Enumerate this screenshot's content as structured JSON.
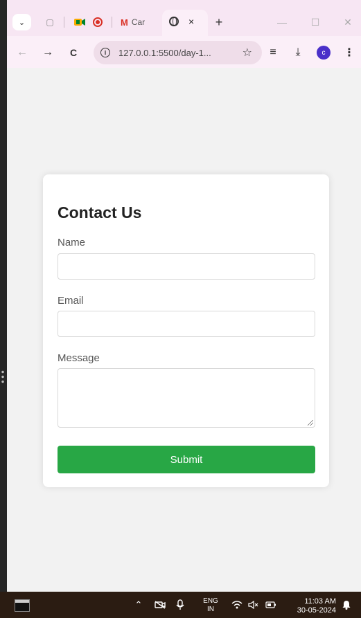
{
  "browser": {
    "tabs": {
      "gmail_title": "Car",
      "active_close": "×",
      "new_tab": "+"
    },
    "window_controls": {
      "minimize": "—",
      "maximize": "☐",
      "close": "✕"
    },
    "toolbar": {
      "back": "←",
      "forward": "→",
      "reload": "C",
      "url": "127.0.0.1:5500/day-1...",
      "star": "☆",
      "reading_list": "≡",
      "download": "⤓",
      "profile_initial": "c",
      "menu": "⋮"
    }
  },
  "form": {
    "title": "Contact Us",
    "name_label": "Name",
    "name_value": "",
    "email_label": "Email",
    "email_value": "",
    "message_label": "Message",
    "message_value": "",
    "submit_label": "Submit"
  },
  "taskbar": {
    "lang_line1": "ENG",
    "lang_line2": "IN",
    "time": "11:03 AM",
    "date": "30-05-2024"
  }
}
